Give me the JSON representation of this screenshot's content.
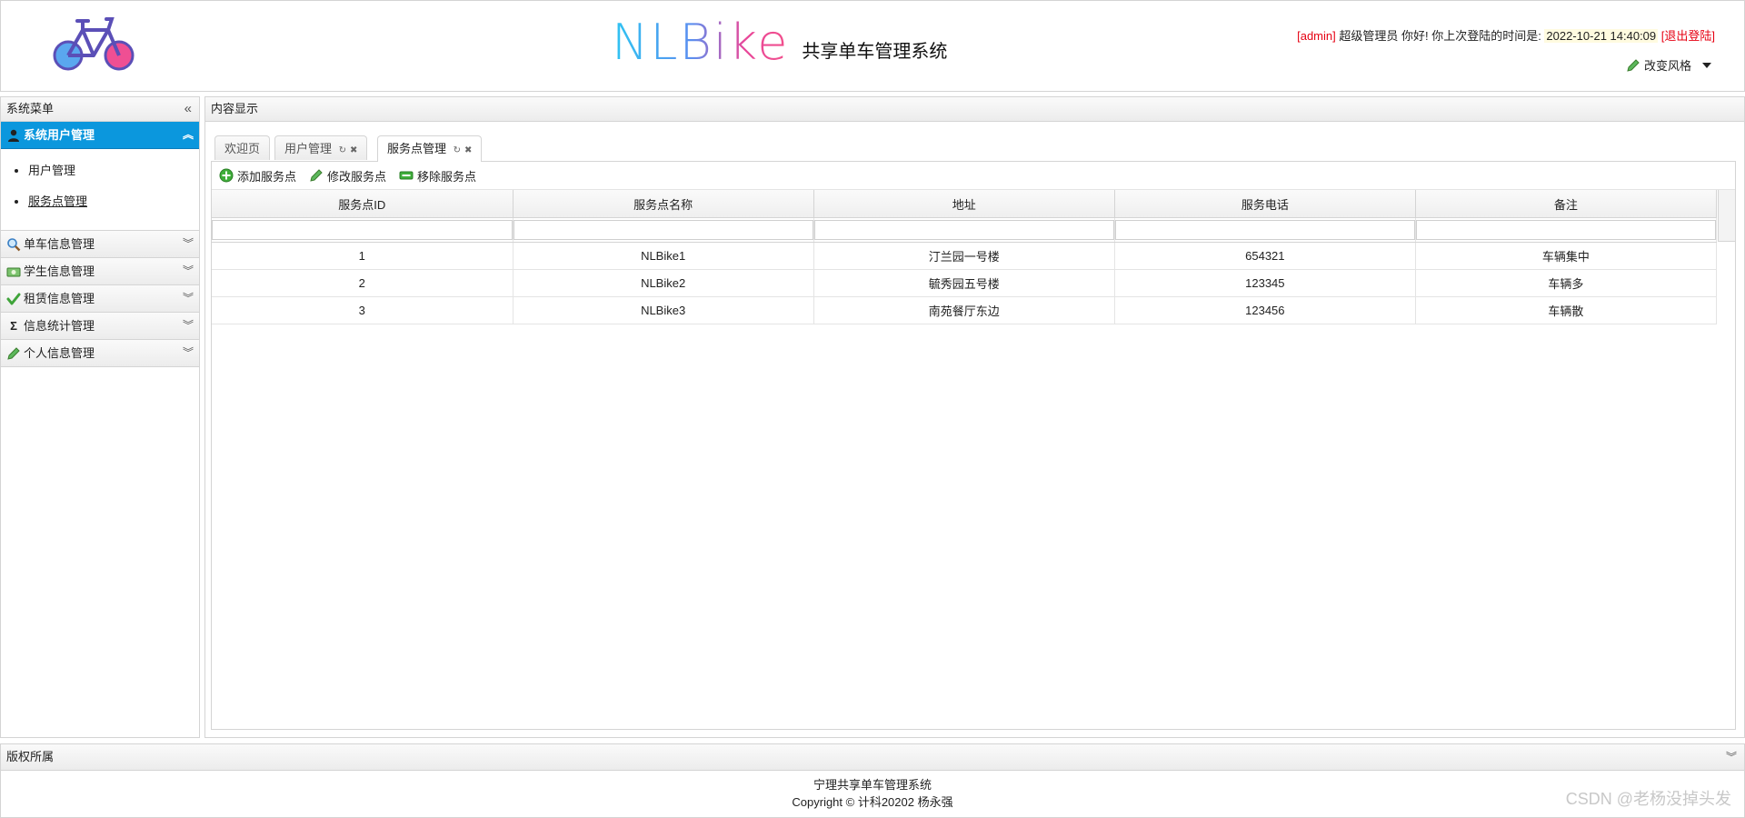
{
  "header": {
    "brand_name": "NLBike",
    "brand_subtitle": "共享单车管理系统",
    "user_tag": "[admin]",
    "greeting": " 超级管理员 你好! 你上次登陆的时间是: ",
    "last_login": "2022-10-21 14:40:09",
    "logout_label": "[退出登陆]",
    "theme_label": "改变风格"
  },
  "sidebar": {
    "title": "系统菜单",
    "groups": [
      {
        "label": "系统用户管理",
        "icon": "user-icon",
        "expanded": true,
        "items": [
          "用户管理",
          "服务点管理"
        ]
      },
      {
        "label": "单车信息管理",
        "icon": "search-icon"
      },
      {
        "label": "学生信息管理",
        "icon": "money-icon"
      },
      {
        "label": "租赁信息管理",
        "icon": "check-icon"
      },
      {
        "label": "信息统计管理",
        "icon": "sigma-icon"
      },
      {
        "label": "个人信息管理",
        "icon": "pencil-icon"
      }
    ]
  },
  "content": {
    "title": "内容显示",
    "tabs": [
      "欢迎页",
      "用户管理",
      "服务点管理"
    ],
    "toolbar": {
      "add": "添加服务点",
      "edit": "修改服务点",
      "remove": "移除服务点"
    },
    "columns": [
      "服务点ID",
      "服务点名称",
      "地址",
      "服务电话",
      "备注"
    ],
    "rows": [
      [
        "1",
        "NLBike1",
        "汀兰园一号楼",
        "654321",
        "车辆集中"
      ],
      [
        "2",
        "NLBike2",
        "毓秀园五号楼",
        "123345",
        "车辆多"
      ],
      [
        "3",
        "NLBike3",
        "南苑餐厅东边",
        "123456",
        "车辆散"
      ]
    ]
  },
  "footer": {
    "title": "版权所属",
    "line1": "宁理共享单车管理系统",
    "line2": "Copyright © 计科20202 杨永强",
    "watermark": "CSDN @老杨没掉头发"
  },
  "colors": {
    "accent": "#0b97dd",
    "danger": "#e60012",
    "border": "#d4d4d4"
  }
}
